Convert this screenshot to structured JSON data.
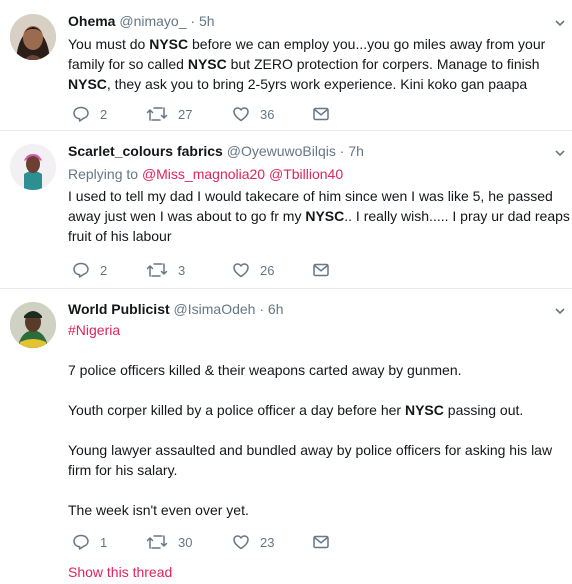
{
  "tweets": [
    {
      "name": "Ohema",
      "handle": "@nimayo_",
      "dot": "·",
      "time": "5h",
      "lines": [
        [
          "You must do ",
          {
            "b": "NYSC"
          },
          " before we can employ you...you go miles away from your"
        ],
        [
          "family for so called ",
          {
            "b": "NYSC"
          },
          " but ZERO protection for corpers. Manage to finish"
        ],
        [
          {
            "b": "NYSC"
          },
          ", they ask you to bring 2-5yrs work experience. Kini koko gan paapa"
        ]
      ],
      "replies": "2",
      "retweets": "27",
      "likes": "36"
    },
    {
      "name": "Scarlet_colours fabrics",
      "handle": "@OyewuwoBilqis",
      "dot": "·",
      "time": "7h",
      "replying_label": "Replying to",
      "replying_to": [
        "@Miss_magnolia20",
        "@Tbillion40"
      ],
      "lines": [
        [
          "I used to tell my dad I would takecare of him since wen I was like 5, he passed"
        ],
        [
          "away just wen I was about to go fr my ",
          {
            "b": "NYSC"
          },
          ".. I really wish..... I pray ur dad reaps d"
        ],
        [
          "fruit of his labour"
        ]
      ],
      "replies": "2",
      "retweets": "3",
      "likes": "26"
    },
    {
      "name": "World Publicist",
      "handle": "@IsimaOdeh",
      "dot": "·",
      "time": "6h",
      "hashtag": "#Nigeria",
      "paragraphs": [
        [
          [
            "7 police officers killed & their weapons carted away by gunmen."
          ]
        ],
        [
          [
            "Youth corper killed by a police officer a day before her ",
            {
              "b": "NYSC"
            },
            " passing out."
          ]
        ],
        [
          [
            "Young lawyer assaulted and bundled away by police officers for asking his law"
          ],
          [
            "firm for his salary."
          ]
        ],
        [
          [
            "The week isn't even over yet."
          ]
        ]
      ],
      "replies": "1",
      "retweets": "30",
      "likes": "23",
      "show_thread": "Show this thread"
    }
  ],
  "icons": {
    "reply": "reply-icon",
    "retweet": "retweet-icon",
    "like": "heart-icon",
    "dm": "envelope-icon",
    "more": "chevron-down-icon"
  },
  "colors": {
    "accent": "#e0245e",
    "muted": "#657786",
    "text": "#14171a",
    "divider": "#e6ecf0"
  }
}
